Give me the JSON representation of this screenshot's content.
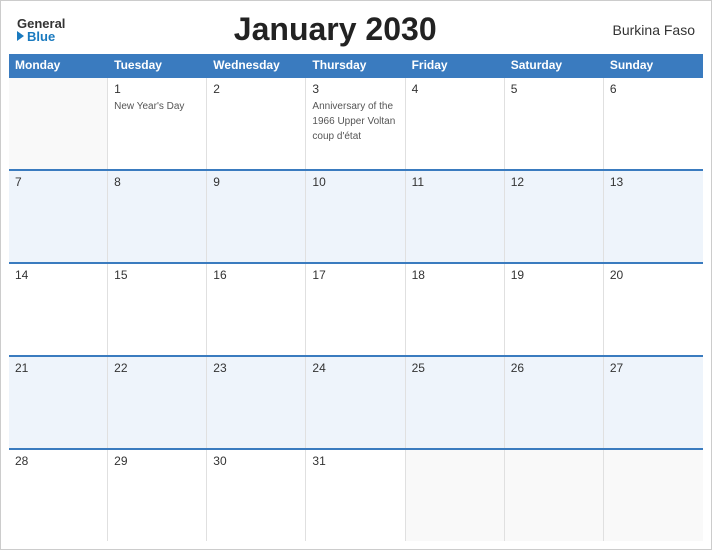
{
  "header": {
    "title": "January 2030",
    "country": "Burkina Faso",
    "logo_general": "General",
    "logo_blue": "Blue"
  },
  "days_of_week": [
    "Monday",
    "Tuesday",
    "Wednesday",
    "Thursday",
    "Friday",
    "Saturday",
    "Sunday"
  ],
  "weeks": [
    [
      {
        "date": "",
        "event": "",
        "empty": true
      },
      {
        "date": "1",
        "event": "New Year's Day",
        "empty": false
      },
      {
        "date": "2",
        "event": "",
        "empty": false
      },
      {
        "date": "3",
        "event": "Anniversary of the 1966 Upper Voltan coup d'état",
        "empty": false
      },
      {
        "date": "4",
        "event": "",
        "empty": false
      },
      {
        "date": "5",
        "event": "",
        "empty": false
      },
      {
        "date": "6",
        "event": "",
        "empty": false
      }
    ],
    [
      {
        "date": "7",
        "event": "",
        "empty": false
      },
      {
        "date": "8",
        "event": "",
        "empty": false
      },
      {
        "date": "9",
        "event": "",
        "empty": false
      },
      {
        "date": "10",
        "event": "",
        "empty": false
      },
      {
        "date": "11",
        "event": "",
        "empty": false
      },
      {
        "date": "12",
        "event": "",
        "empty": false
      },
      {
        "date": "13",
        "event": "",
        "empty": false
      }
    ],
    [
      {
        "date": "14",
        "event": "",
        "empty": false
      },
      {
        "date": "15",
        "event": "",
        "empty": false
      },
      {
        "date": "16",
        "event": "",
        "empty": false
      },
      {
        "date": "17",
        "event": "",
        "empty": false
      },
      {
        "date": "18",
        "event": "",
        "empty": false
      },
      {
        "date": "19",
        "event": "",
        "empty": false
      },
      {
        "date": "20",
        "event": "",
        "empty": false
      }
    ],
    [
      {
        "date": "21",
        "event": "",
        "empty": false
      },
      {
        "date": "22",
        "event": "",
        "empty": false
      },
      {
        "date": "23",
        "event": "",
        "empty": false
      },
      {
        "date": "24",
        "event": "",
        "empty": false
      },
      {
        "date": "25",
        "event": "",
        "empty": false
      },
      {
        "date": "26",
        "event": "",
        "empty": false
      },
      {
        "date": "27",
        "event": "",
        "empty": false
      }
    ],
    [
      {
        "date": "28",
        "event": "",
        "empty": false
      },
      {
        "date": "29",
        "event": "",
        "empty": false
      },
      {
        "date": "30",
        "event": "",
        "empty": false
      },
      {
        "date": "31",
        "event": "",
        "empty": false
      },
      {
        "date": "",
        "event": "",
        "empty": true
      },
      {
        "date": "",
        "event": "",
        "empty": true
      },
      {
        "date": "",
        "event": "",
        "empty": true
      }
    ]
  ]
}
